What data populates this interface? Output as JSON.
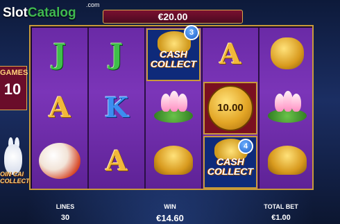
{
  "logo": {
    "slot": "Slot",
    "catalog": "Catalog",
    "com": ".com"
  },
  "balance": "€20.00",
  "left_panel": {
    "label": "GAMES",
    "value": "10"
  },
  "side_text": {
    "line1": "OIN CAI",
    "line2": "COLLECT"
  },
  "reels": [
    [
      "J",
      "A",
      "koi-fish"
    ],
    [
      "J",
      "K",
      "A"
    ],
    [
      "cash-collect",
      "lotus-flower",
      "gold-turtle"
    ],
    [
      "A",
      "coin-10.00",
      "cash-collect"
    ],
    [
      "gold-frog",
      "lotus-flower",
      "gold-turtle"
    ]
  ],
  "symbols": {
    "r1_top": "J",
    "r1_mid": "A",
    "r2_top": "J",
    "r2_mid": "K",
    "r2_bot": "A",
    "r4_top": "A",
    "cash_collect_line1": "CASH",
    "cash_collect_line2": "COLLECT",
    "coin_value": "10.00",
    "badge_1": "3",
    "badge_2": "4"
  },
  "bottom": {
    "lines_label": "LINES",
    "lines_value": "30",
    "win_label": "WIN",
    "win_value": "€14.60",
    "bet_label": "TOTAL BET",
    "bet_value": "€1.00"
  },
  "colors": {
    "reel_purple": "#7b35b8",
    "frame_gold": "#c89a3a",
    "balance_red": "#7a1030"
  }
}
